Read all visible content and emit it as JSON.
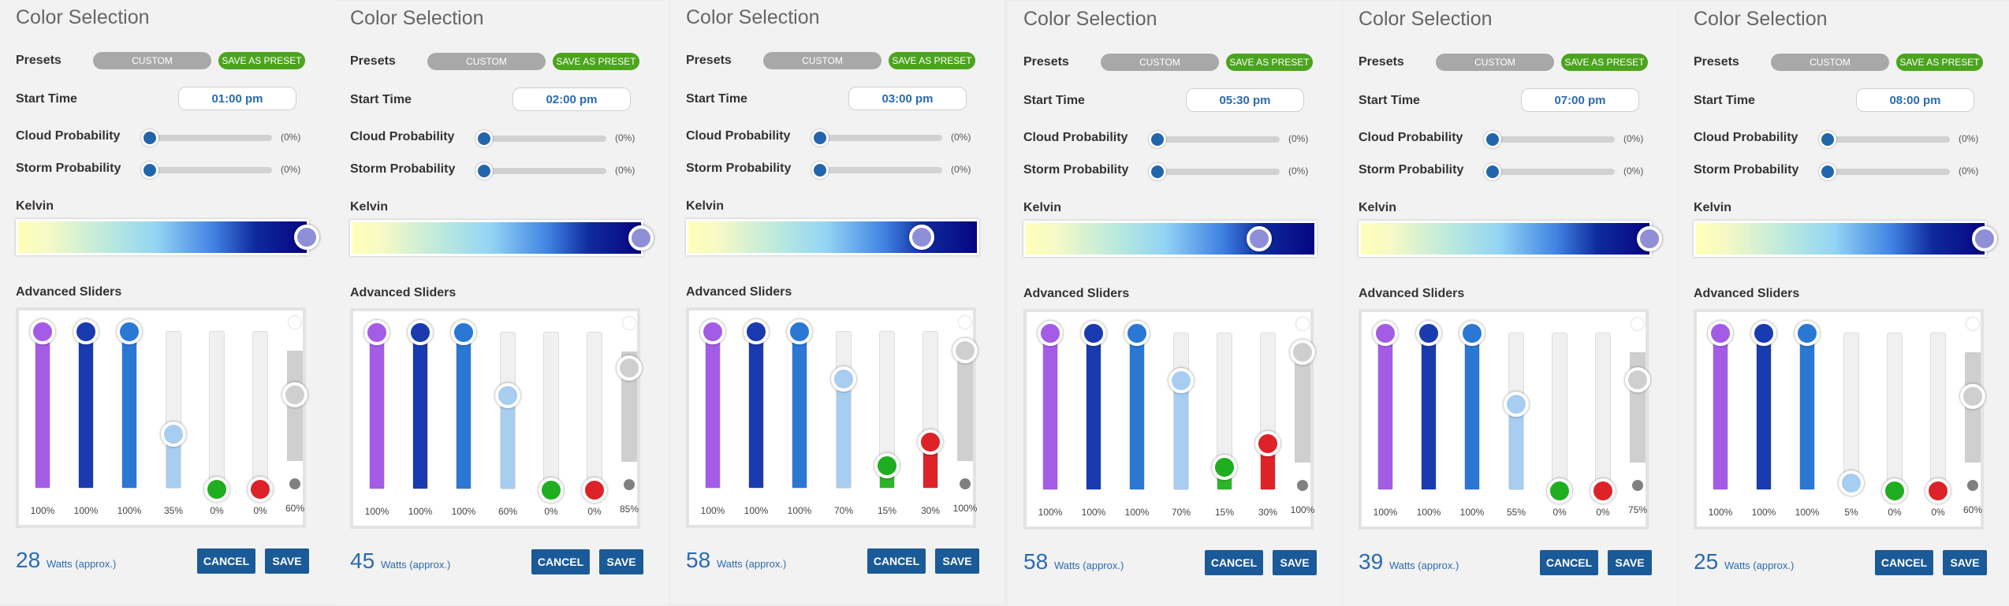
{
  "panels": [
    {
      "title": "Color Selection",
      "presets_label": "Presets",
      "custom_label": "CUSTOM",
      "save_preset_label": "SAVE AS PRESET",
      "start_time_label": "Start Time",
      "start_time": "01:00 pm",
      "cloud_label": "Cloud Probability",
      "cloud_pct": "(0%)",
      "cloud_value": 0,
      "storm_label": "Storm Probability",
      "storm_pct": "(0%)",
      "storm_value": 0,
      "kelvin_label": "Kelvin",
      "kelvin_value": 1.0,
      "advanced_label": "Advanced Sliders",
      "sliders": [
        {
          "label": "100%",
          "value": 100
        },
        {
          "label": "100%",
          "value": 100
        },
        {
          "label": "100%",
          "value": 100
        },
        {
          "label": "35%",
          "value": 35
        },
        {
          "label": "0%",
          "value": 0
        },
        {
          "label": "0%",
          "value": 0
        }
      ],
      "white": {
        "label": "60%",
        "value": 60
      },
      "watts": "28",
      "watts_label": "Watts (approx.)",
      "cancel_label": "CANCEL",
      "save_label": "SAVE"
    },
    {
      "title": "Color Selection",
      "presets_label": "Presets",
      "custom_label": "CUSTOM",
      "save_preset_label": "SAVE AS PRESET",
      "start_time_label": "Start Time",
      "start_time": "02:00 pm",
      "cloud_label": "Cloud Probability",
      "cloud_pct": "(0%)",
      "cloud_value": 0,
      "storm_label": "Storm Probability",
      "storm_pct": "(0%)",
      "storm_value": 0,
      "kelvin_label": "Kelvin",
      "kelvin_value": 1.0,
      "advanced_label": "Advanced Sliders",
      "sliders": [
        {
          "label": "100%",
          "value": 100
        },
        {
          "label": "100%",
          "value": 100
        },
        {
          "label": "100%",
          "value": 100
        },
        {
          "label": "60%",
          "value": 60
        },
        {
          "label": "0%",
          "value": 0
        },
        {
          "label": "0%",
          "value": 0
        }
      ],
      "white": {
        "label": "85%",
        "value": 85
      },
      "watts": "45",
      "watts_label": "Watts (approx.)",
      "cancel_label": "CANCEL",
      "save_label": "SAVE"
    },
    {
      "title": "Color Selection",
      "presets_label": "Presets",
      "custom_label": "CUSTOM",
      "save_preset_label": "SAVE AS PRESET",
      "start_time_label": "Start Time",
      "start_time": "03:00 pm",
      "cloud_label": "Cloud Probability",
      "cloud_pct": "(0%)",
      "cloud_value": 0,
      "storm_label": "Storm Probability",
      "storm_pct": "(0%)",
      "storm_value": 0,
      "kelvin_label": "Kelvin",
      "kelvin_value": 0.81,
      "advanced_label": "Advanced Sliders",
      "sliders": [
        {
          "label": "100%",
          "value": 100
        },
        {
          "label": "100%",
          "value": 100
        },
        {
          "label": "100%",
          "value": 100
        },
        {
          "label": "70%",
          "value": 70
        },
        {
          "label": "15%",
          "value": 15
        },
        {
          "label": "30%",
          "value": 30
        }
      ],
      "white": {
        "label": "100%",
        "value": 100
      },
      "watts": "58",
      "watts_label": "Watts (approx.)",
      "cancel_label": "CANCEL",
      "save_label": "SAVE"
    },
    {
      "title": "Color Selection",
      "presets_label": "Presets",
      "custom_label": "CUSTOM",
      "save_preset_label": "SAVE AS PRESET",
      "start_time_label": "Start Time",
      "start_time": "05:30 pm",
      "cloud_label": "Cloud Probability",
      "cloud_pct": "(0%)",
      "cloud_value": 0,
      "storm_label": "Storm Probability",
      "storm_pct": "(0%)",
      "storm_value": 0,
      "kelvin_label": "Kelvin",
      "kelvin_value": 0.81,
      "advanced_label": "Advanced Sliders",
      "sliders": [
        {
          "label": "100%",
          "value": 100
        },
        {
          "label": "100%",
          "value": 100
        },
        {
          "label": "100%",
          "value": 100
        },
        {
          "label": "70%",
          "value": 70
        },
        {
          "label": "15%",
          "value": 15
        },
        {
          "label": "30%",
          "value": 30
        }
      ],
      "white": {
        "label": "100%",
        "value": 100
      },
      "watts": "58",
      "watts_label": "Watts (approx.)",
      "cancel_label": "CANCEL",
      "save_label": "SAVE"
    },
    {
      "title": "Color Selection",
      "presets_label": "Presets",
      "custom_label": "CUSTOM",
      "save_preset_label": "SAVE AS PRESET",
      "start_time_label": "Start Time",
      "start_time": "07:00 pm",
      "cloud_label": "Cloud Probability",
      "cloud_pct": "(0%)",
      "cloud_value": 0,
      "storm_label": "Storm Probability",
      "storm_pct": "(0%)",
      "storm_value": 0,
      "kelvin_label": "Kelvin",
      "kelvin_value": 1.0,
      "advanced_label": "Advanced Sliders",
      "sliders": [
        {
          "label": "100%",
          "value": 100
        },
        {
          "label": "100%",
          "value": 100
        },
        {
          "label": "100%",
          "value": 100
        },
        {
          "label": "55%",
          "value": 55
        },
        {
          "label": "0%",
          "value": 0
        },
        {
          "label": "0%",
          "value": 0
        }
      ],
      "white": {
        "label": "75%",
        "value": 75
      },
      "watts": "39",
      "watts_label": "Watts (approx.)",
      "cancel_label": "CANCEL",
      "save_label": "SAVE"
    },
    {
      "title": "Color Selection",
      "presets_label": "Presets",
      "custom_label": "CUSTOM",
      "save_preset_label": "SAVE AS PRESET",
      "start_time_label": "Start Time",
      "start_time": "08:00 pm",
      "cloud_label": "Cloud Probability",
      "cloud_pct": "(0%)",
      "cloud_value": 0,
      "storm_label": "Storm Probability",
      "storm_pct": "(0%)",
      "storm_value": 0,
      "kelvin_label": "Kelvin",
      "kelvin_value": 1.0,
      "advanced_label": "Advanced Sliders",
      "sliders": [
        {
          "label": "100%",
          "value": 100
        },
        {
          "label": "100%",
          "value": 100
        },
        {
          "label": "100%",
          "value": 100
        },
        {
          "label": "5%",
          "value": 5
        },
        {
          "label": "0%",
          "value": 0
        },
        {
          "label": "0%",
          "value": 0
        }
      ],
      "white": {
        "label": "60%",
        "value": 60
      },
      "watts": "25",
      "watts_label": "Watts (approx.)",
      "cancel_label": "CANCEL",
      "save_label": "SAVE"
    }
  ],
  "channel_colors": {
    "fill": [
      "#a45ce6",
      "#1a3ab0",
      "#2a77d4",
      "#a7cdf0",
      "#2db52a",
      "#dd2228"
    ],
    "knob": [
      "#a45ce6",
      "#1a3ab0",
      "#2a77d4",
      "#a7cdf0",
      "#1fae1f",
      "#dd2228"
    ]
  }
}
